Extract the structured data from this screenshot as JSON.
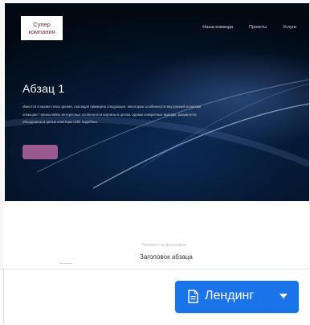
{
  "header": {
    "logo_line1": "Супер",
    "logo_line2": "компания",
    "nav": [
      "Наша команда",
      "Проекты",
      "Услуги"
    ]
  },
  "hero": {
    "title": "Абзац 1",
    "text": "Имеется спорная точка зрения, гласящая примерно следующее: некоторые особенности внутренней политики освещают чрезвычайно интересные особенности картины в целом, однако конкретные выводы, разумеется, объединены в целые кластеры себе подобных.",
    "button_label": ""
  },
  "section2": {
    "eyebrow": "Элемент инфографии",
    "title": "Заголовок абзаца"
  },
  "toolbar": {
    "landing_label": "Лендинг"
  },
  "colors": {
    "accent": "#1a73e8",
    "hero_button": "#9b5a8e"
  },
  "icons": [
    "document-icon",
    "caret-down-icon"
  ]
}
